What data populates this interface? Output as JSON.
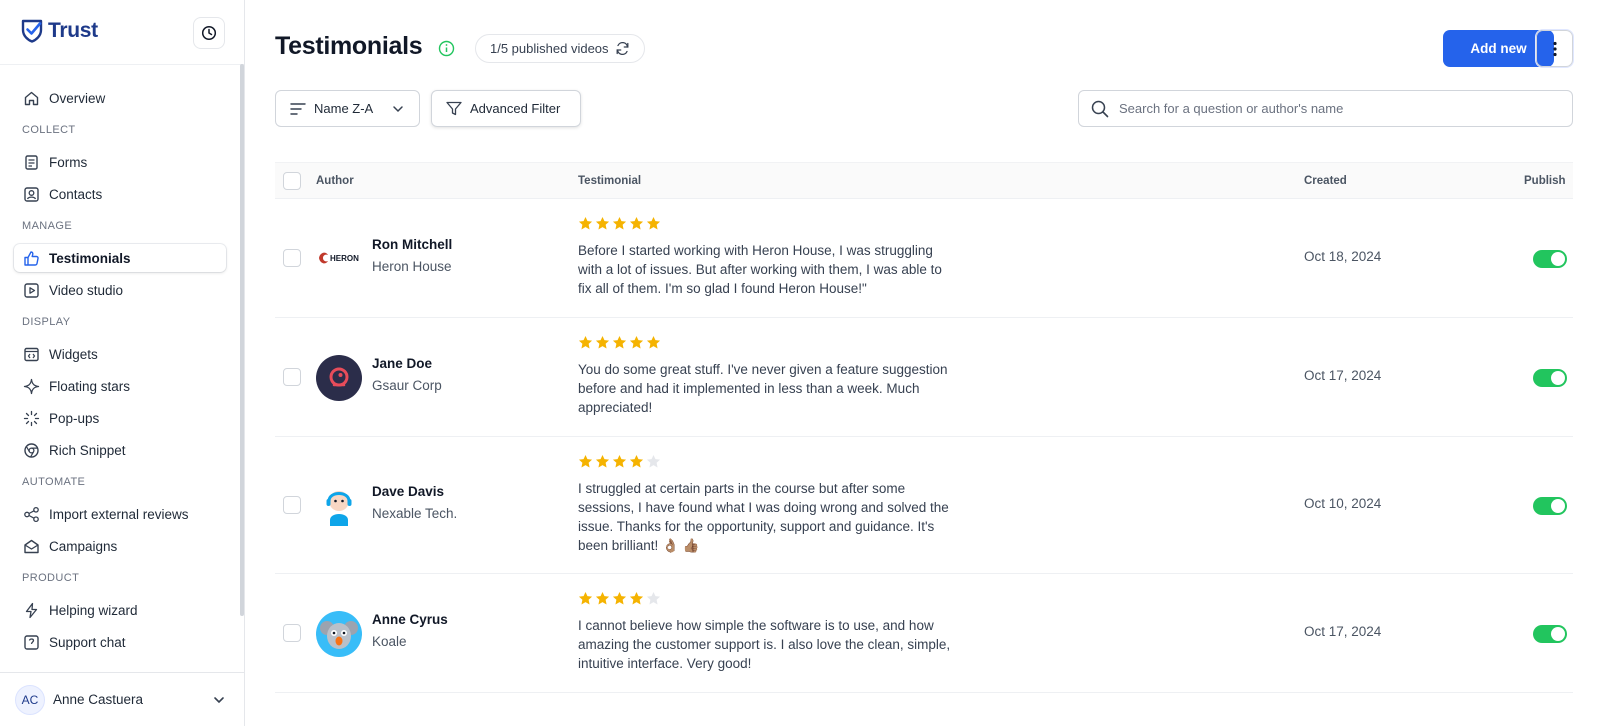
{
  "brand": {
    "name": "Trust"
  },
  "sidebar": {
    "overview": "Overview",
    "sections": {
      "collect": "COLLECT",
      "manage": "MANAGE",
      "display": "DISPLAY",
      "automate": "AUTOMATE",
      "product": "PRODUCT"
    },
    "items": {
      "forms": "Forms",
      "contacts": "Contacts",
      "testimonials": "Testimonials",
      "video_studio": "Video studio",
      "widgets": "Widgets",
      "floating_stars": "Floating stars",
      "popups": "Pop-ups",
      "rich_snippet": "Rich Snippet",
      "import_reviews": "Import external reviews",
      "campaigns": "Campaigns",
      "helping_wizard": "Helping wizard",
      "support_chat": "Support chat"
    },
    "user": {
      "initials": "AC",
      "name": "Anne Castuera"
    }
  },
  "header": {
    "title": "Testimonials",
    "published": "1/5 published videos",
    "add_label": "Add new"
  },
  "toolbar": {
    "sort_label": "Name Z-A",
    "filter_label": "Advanced Filter",
    "search_placeholder": "Search for a question or author's name"
  },
  "table": {
    "columns": {
      "author": "Author",
      "testimonial": "Testimonial",
      "created": "Created",
      "publish": "Publish"
    },
    "rows": [
      {
        "name": "Ron Mitchell",
        "company": "Heron House",
        "rating": 5,
        "text": "Before I started working with Heron House, I was struggling with a lot of issues. But after working with them, I was able to fix all of them. I'm so glad I found Heron House!\"",
        "created": "Oct 18, 2024",
        "published": true,
        "logo_text": "HERON"
      },
      {
        "name": "Jane Doe",
        "company": "Gsaur Corp",
        "rating": 5,
        "text": "You do some great stuff. I've never given a feature suggestion before and had it implemented in less than a week. Much appreciated!",
        "created": "Oct 17, 2024",
        "published": true
      },
      {
        "name": "Dave Davis",
        "company": "Nexable Tech.",
        "rating": 4,
        "text": "I struggled at certain parts in the course but after some sessions, I have found what I was doing wrong and solved the issue. Thanks for the opportunity, support and guidance. It's been brilliant! 👌🏽 👍🏽",
        "created": "Oct 10, 2024",
        "published": true
      },
      {
        "name": "Anne Cyrus",
        "company": "Koale",
        "rating": 4,
        "text": "I cannot believe how simple the software is to use, and how amazing the customer support is. I also love the clean, simple, intuitive interface. Very good!",
        "created": "Oct 17, 2024",
        "published": true
      }
    ]
  },
  "colors": {
    "accent": "#2563eb",
    "brand": "#1e3a8a",
    "star": "#f5b301",
    "toggle_on": "#22c55e"
  }
}
